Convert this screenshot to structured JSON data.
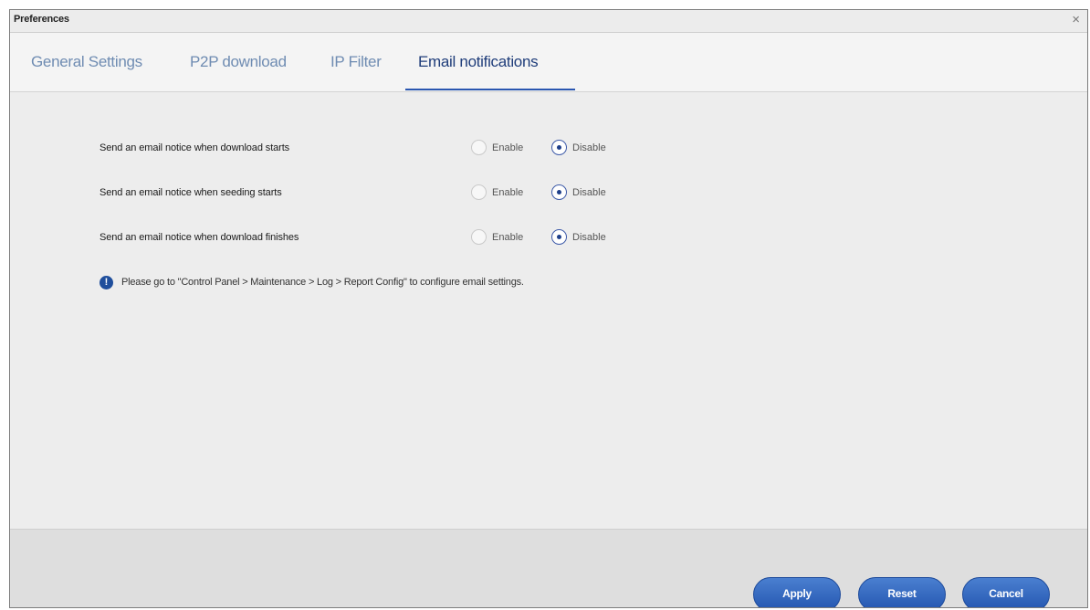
{
  "window": {
    "title": "Preferences",
    "close_glyph": "×"
  },
  "tabs": [
    {
      "label": "General Settings",
      "active": false
    },
    {
      "label": "P2P download",
      "active": false
    },
    {
      "label": "IP Filter",
      "active": false
    },
    {
      "label": "Email notifications",
      "active": true
    }
  ],
  "settings": [
    {
      "label": "Send an email notice when download starts",
      "enable_label": "Enable",
      "disable_label": "Disable",
      "selected": "Disable"
    },
    {
      "label": "Send an email notice when seeding starts",
      "enable_label": "Enable",
      "disable_label": "Disable",
      "selected": "Disable"
    },
    {
      "label": "Send an email notice when download finishes",
      "enable_label": "Enable",
      "disable_label": "Disable",
      "selected": "Disable"
    }
  ],
  "notice": {
    "icon": "info-icon",
    "icon_glyph": "!",
    "text": "Please go to \"Control Panel > Maintenance > Log > Report Config\" to configure email settings."
  },
  "footer": {
    "apply_label": "Apply",
    "reset_label": "Reset",
    "cancel_label": "Cancel"
  },
  "colors": {
    "accent": "#2456b0",
    "tab_inactive": "#6f8cb2",
    "tab_active": "#1f3d7a"
  }
}
